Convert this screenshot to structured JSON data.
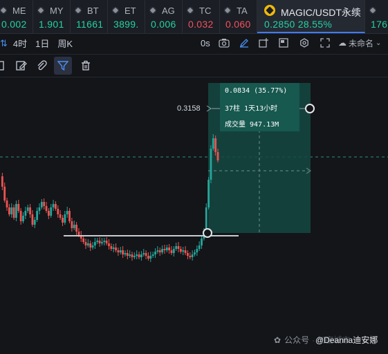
{
  "tickers": [
    {
      "symbol": "ME",
      "value": "0.002",
      "color": "#25d2a3"
    },
    {
      "symbol": "MY",
      "value": "1.901",
      "color": "#25d2a3"
    },
    {
      "symbol": "BT",
      "value": "11661",
      "color": "#25d2a3"
    },
    {
      "symbol": "ET",
      "value": "3899.",
      "color": "#25d2a3"
    },
    {
      "symbol": "AG",
      "value": "0.006",
      "color": "#25d2a3"
    },
    {
      "symbol": "TC",
      "value": "0.032",
      "color": "#f0525f"
    },
    {
      "symbol": "TA",
      "value": "0.060",
      "color": "#f0525f"
    }
  ],
  "active_ticker": {
    "symbol": "MAGIC/USDT永续",
    "value": "0.2850  28.55%",
    "color": "#25d2a3"
  },
  "trailing_ticker": {
    "value": "176"
  },
  "toolbar": {
    "timeframes": [
      "4时",
      "1日",
      "周K"
    ],
    "seconds_label": "0s",
    "unnamed_label": "未命名"
  },
  "measurement": {
    "line1": "0.0834 (35.77%)",
    "line2": "37柱 1天13小时",
    "line3": "成交量 947.13M",
    "price_label": "0.3158"
  },
  "watermark": {
    "text": "公众号",
    "faint": "· 加密城市",
    "user": "@Deanna迪安娜"
  },
  "colors": {
    "up": "#26a69a",
    "down": "#ef5350",
    "accent": "#3f7cf6"
  }
}
